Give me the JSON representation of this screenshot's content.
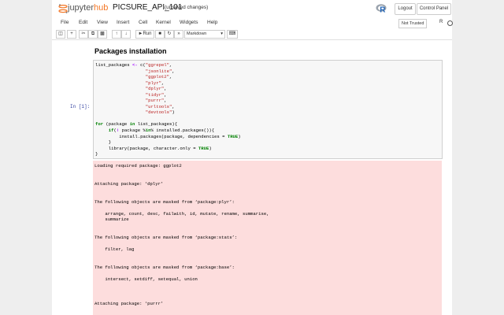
{
  "header": {
    "logo_jupyter": "jupyter",
    "logo_hub": "hub",
    "notebook_title": "PICSURE_API_101",
    "save_status": "(unsaved changes)",
    "logout_label": "Logout",
    "control_panel_label": "Control Panel"
  },
  "menubar": {
    "items": [
      "File",
      "Edit",
      "View",
      "Insert",
      "Cell",
      "Kernel",
      "Widgets",
      "Help"
    ],
    "trusted_label": "Not Trusted",
    "kernel_label": "R"
  },
  "toolbar": {
    "run_label": "Run",
    "cell_type": "Markdown",
    "icons": [
      "save-icon",
      "add-icon",
      "cut-icon",
      "copy-icon",
      "paste-icon",
      "move-up-icon",
      "move-down-icon",
      "run-icon",
      "stop-icon",
      "restart-icon",
      "restart-run-icon",
      "command-palette-icon"
    ]
  },
  "notebook": {
    "markdown_heading": "Packages installation",
    "prompt": "In [1]:",
    "code_lines": [
      "list_packages <- c(\"ggrepel\",",
      "                   \"jsonlite\",",
      "                   \"ggplot2\",",
      "                   \"plyr\",",
      "                   \"dplyr\",",
      "                   \"tidyr\",",
      "                   \"purrr\",",
      "                   \"urltools\",",
      "                   \"devtools\")",
      "",
      "for (package in list_packages){",
      "     if(! package %in% installed.packages()){",
      "         install.packages(package, dependencies = TRUE)",
      "     }",
      "     library(package, character.only = TRUE)",
      "}"
    ],
    "output_lines": [
      "Loading required package: ggplot2",
      "",
      "",
      "Attaching package: ‘dplyr’",
      "",
      "",
      "The following objects are masked from ‘package:plyr’:",
      "",
      "    arrange, count, desc, failwith, id, mutate, rename, summarise,",
      "    summarize",
      "",
      "",
      "The following objects are masked from ‘package:stats’:",
      "",
      "    filter, lag",
      "",
      "",
      "The following objects are masked from ‘package:base’:",
      "",
      "    intersect, setdiff, setequal, union",
      "",
      "",
      "",
      "Attaching package: ‘purrr’"
    ]
  }
}
